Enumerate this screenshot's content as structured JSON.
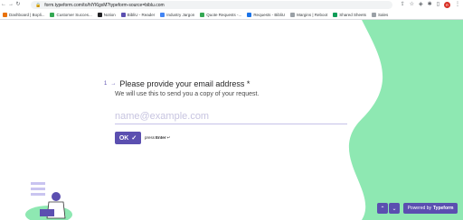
{
  "browser": {
    "url": "form.typeform.com/to/hlYl6gxM?typeform-source=biblu.com",
    "bookmarks": [
      {
        "label": "Dashboard | Bopli...",
        "color": "#e8710a"
      },
      {
        "label": "Customer Succes...",
        "color": "#34a853"
      },
      {
        "label": "Notion",
        "color": "#202124"
      },
      {
        "label": "BibliU - Reader",
        "color": "#5b4fb0"
      },
      {
        "label": "Industry Jargon",
        "color": "#4285f4"
      },
      {
        "label": "Quote Requests -...",
        "color": "#34a853"
      },
      {
        "label": "Requests - BibliU",
        "color": "#1a73e8"
      },
      {
        "label": "Margins | Reboot",
        "color": "#9aa0a6"
      },
      {
        "label": "Shared Sheets",
        "color": "#0f9d58"
      },
      {
        "label": "Sales",
        "color": "#9aa0a6"
      }
    ],
    "profile_initial": "R"
  },
  "form": {
    "question_number": "1",
    "question_title": "Please provide your email address *",
    "question_description": "We will use this to send you a copy of your request.",
    "email_placeholder": "name@example.com",
    "email_value": "",
    "ok_label": "OK",
    "press": "press",
    "enter": "Enter",
    "enter_symbol": "↵"
  },
  "footer": {
    "powered_by": "Powered by",
    "brand": "Typeform"
  },
  "colors": {
    "accent": "#5b4fb0",
    "green": "#8ee8b2",
    "text": "#262627"
  },
  "icons": {
    "back": "arrow-left-icon",
    "forward": "arrow-right-icon",
    "reload": "reload-icon",
    "lock": "lock-icon",
    "star": "star-icon",
    "extensions": "puzzle-icon",
    "check": "check-icon",
    "chevron_up": "chevron-up-icon",
    "chevron_down": "chevron-down-icon"
  }
}
